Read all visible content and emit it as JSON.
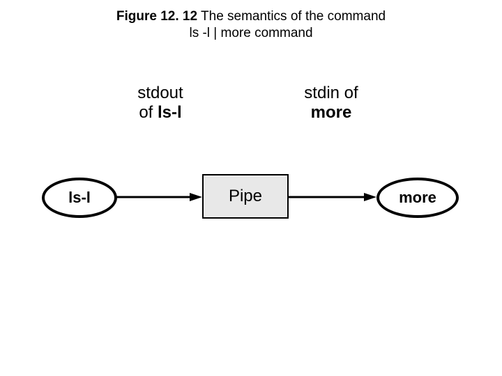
{
  "caption": {
    "figure_label": "Figure 12. 12",
    "title_line1": "The semantics of the command",
    "title_line2": "ls -l | more command"
  },
  "diagram": {
    "left_label_line1": "stdout",
    "left_label_line2_pre": "of ",
    "left_label_line2_bold": "ls-l",
    "right_label_line1": "stdin of",
    "right_label_line2_bold": "more",
    "node_ls": "ls-l",
    "node_pipe": "Pipe",
    "node_more": "more"
  }
}
